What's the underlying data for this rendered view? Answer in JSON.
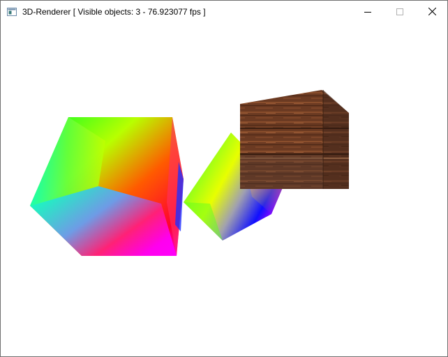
{
  "window": {
    "title": "3D-Renderer [ Visible objects: 3 - 76.923077 fps ]",
    "icon": "app-window-icon",
    "controls": {
      "minimize_icon": "minimize-icon",
      "maximize_icon": "maximize-icon",
      "close_icon": "close-icon"
    }
  },
  "scene": {
    "background": "#ffffff",
    "objects": [
      {
        "name": "rainbow-cube-large",
        "material": "vertex-color gradient"
      },
      {
        "name": "rainbow-cube-small",
        "material": "vertex-color gradient"
      },
      {
        "name": "wooden-crate",
        "material": "wood texture"
      }
    ]
  }
}
